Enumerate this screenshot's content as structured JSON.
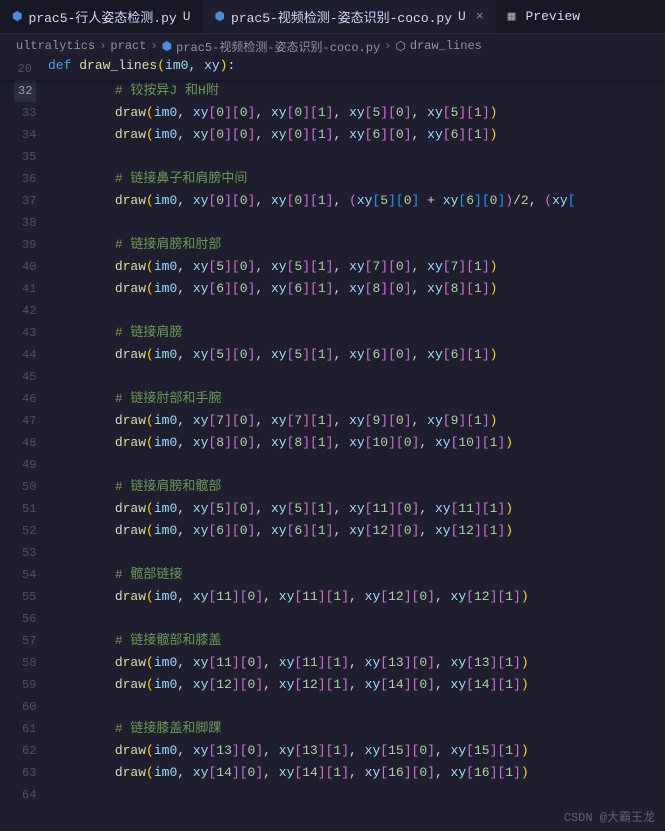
{
  "tabs": [
    {
      "label": "prac5-行人姿态检测.py",
      "modified": "U",
      "active": false
    },
    {
      "label": "prac5-视频检测-姿态识别-coco.py",
      "modified": "U",
      "active": true
    },
    {
      "label": "Preview",
      "active": false,
      "preview": true
    }
  ],
  "breadcrumb": {
    "segments": [
      "ultralytics",
      "pract",
      "prac5-视频检测-姿态识别-coco.py",
      "draw_lines"
    ]
  },
  "def_line_no": 20,
  "def_text": {
    "kw": "def",
    "name": "draw_lines",
    "params": [
      "im0",
      "xy"
    ]
  },
  "highlight_badge": 32,
  "lines": [
    {
      "n": "",
      "type": "comment_frag",
      "text": "# 铰按异J 和H附"
    },
    {
      "n": 33,
      "type": "draw4",
      "a": [
        0,
        0
      ],
      "b": [
        0,
        1
      ],
      "c": [
        5,
        0
      ],
      "d": [
        5,
        1
      ]
    },
    {
      "n": 34,
      "type": "draw4",
      "a": [
        0,
        0
      ],
      "b": [
        0,
        1
      ],
      "c": [
        6,
        0
      ],
      "d": [
        6,
        1
      ]
    },
    {
      "n": 35,
      "type": "blank"
    },
    {
      "n": 36,
      "type": "comment",
      "text": "# 链接鼻子和肩膀中间"
    },
    {
      "n": 37,
      "type": "draw_mid",
      "a": [
        0,
        0
      ],
      "b": [
        0,
        1
      ],
      "mid": [
        5,
        0,
        6,
        0
      ]
    },
    {
      "n": 38,
      "type": "blank"
    },
    {
      "n": 39,
      "type": "comment",
      "text": "# 链接肩膀和肘部"
    },
    {
      "n": 40,
      "type": "draw4",
      "a": [
        5,
        0
      ],
      "b": [
        5,
        1
      ],
      "c": [
        7,
        0
      ],
      "d": [
        7,
        1
      ]
    },
    {
      "n": 41,
      "type": "draw4",
      "a": [
        6,
        0
      ],
      "b": [
        6,
        1
      ],
      "c": [
        8,
        0
      ],
      "d": [
        8,
        1
      ]
    },
    {
      "n": 42,
      "type": "blank"
    },
    {
      "n": 43,
      "type": "comment",
      "text": "# 链接肩膀"
    },
    {
      "n": 44,
      "type": "draw4",
      "a": [
        5,
        0
      ],
      "b": [
        5,
        1
      ],
      "c": [
        6,
        0
      ],
      "d": [
        6,
        1
      ]
    },
    {
      "n": 45,
      "type": "blank"
    },
    {
      "n": 46,
      "type": "comment",
      "text": "# 链接肘部和手腕"
    },
    {
      "n": 47,
      "type": "draw4",
      "a": [
        7,
        0
      ],
      "b": [
        7,
        1
      ],
      "c": [
        9,
        0
      ],
      "d": [
        9,
        1
      ]
    },
    {
      "n": 48,
      "type": "draw4",
      "a": [
        8,
        0
      ],
      "b": [
        8,
        1
      ],
      "c": [
        10,
        0
      ],
      "d": [
        10,
        1
      ]
    },
    {
      "n": 49,
      "type": "blank"
    },
    {
      "n": 50,
      "type": "comment",
      "text": "# 链接肩膀和髋部"
    },
    {
      "n": 51,
      "type": "draw4",
      "a": [
        5,
        0
      ],
      "b": [
        5,
        1
      ],
      "c": [
        11,
        0
      ],
      "d": [
        11,
        1
      ]
    },
    {
      "n": 52,
      "type": "draw4",
      "a": [
        6,
        0
      ],
      "b": [
        6,
        1
      ],
      "c": [
        12,
        0
      ],
      "d": [
        12,
        1
      ]
    },
    {
      "n": 53,
      "type": "blank"
    },
    {
      "n": 54,
      "type": "comment",
      "text": "# 髋部链接"
    },
    {
      "n": 55,
      "type": "draw4",
      "a": [
        11,
        0
      ],
      "b": [
        11,
        1
      ],
      "c": [
        12,
        0
      ],
      "d": [
        12,
        1
      ]
    },
    {
      "n": 56,
      "type": "blank"
    },
    {
      "n": 57,
      "type": "comment",
      "text": "# 链接髋部和膝盖"
    },
    {
      "n": 58,
      "type": "draw4",
      "a": [
        11,
        0
      ],
      "b": [
        11,
        1
      ],
      "c": [
        13,
        0
      ],
      "d": [
        13,
        1
      ]
    },
    {
      "n": 59,
      "type": "draw4",
      "a": [
        12,
        0
      ],
      "b": [
        12,
        1
      ],
      "c": [
        14,
        0
      ],
      "d": [
        14,
        1
      ]
    },
    {
      "n": 60,
      "type": "blank"
    },
    {
      "n": 61,
      "type": "comment",
      "text": "# 链接膝盖和脚踝"
    },
    {
      "n": 62,
      "type": "draw4",
      "a": [
        13,
        0
      ],
      "b": [
        13,
        1
      ],
      "c": [
        15,
        0
      ],
      "d": [
        15,
        1
      ]
    },
    {
      "n": 63,
      "type": "draw4",
      "a": [
        14,
        0
      ],
      "b": [
        14,
        1
      ],
      "c": [
        16,
        0
      ],
      "d": [
        16,
        1
      ]
    },
    {
      "n": 64,
      "type": "blank"
    }
  ],
  "watermark": "CSDN @大霸王龙"
}
